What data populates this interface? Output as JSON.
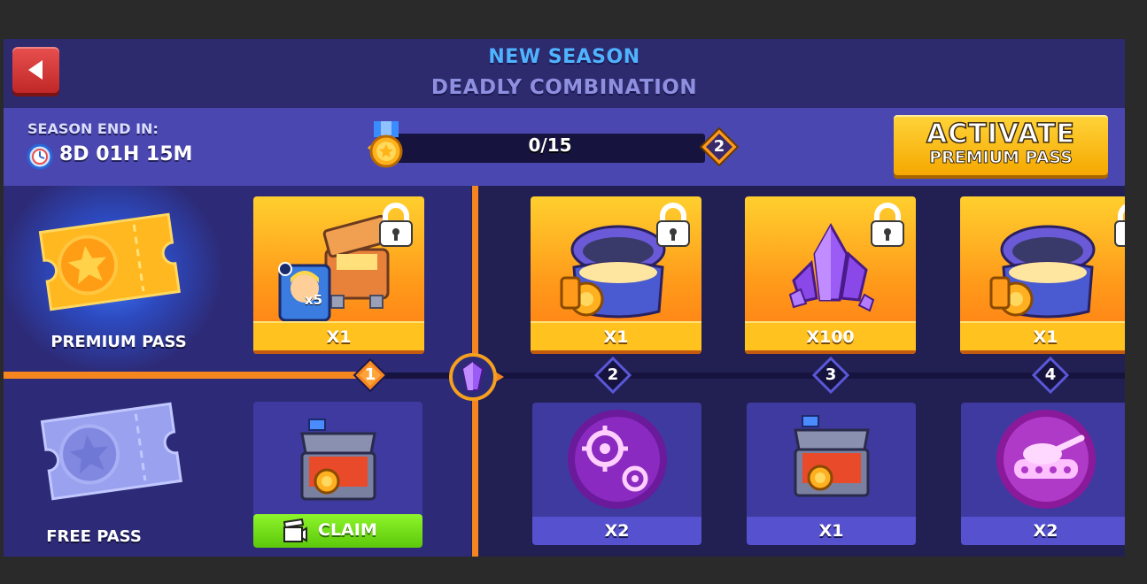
{
  "header": {
    "title": "NEW SEASON",
    "subtitle": "DEADLY COMBINATION",
    "back_icon": "back-arrow-icon"
  },
  "season": {
    "end_label": "SEASON END IN:",
    "time_remaining": "8D 01H 15M"
  },
  "progress": {
    "text": "0/15",
    "current": 0,
    "total": 15,
    "next_level": "2"
  },
  "activate_button": {
    "line1": "ACTIVATE",
    "line2": "PREMIUM PASS"
  },
  "passes": {
    "premium_label": "PREMIUM PASS",
    "free_label": "FREE PASS"
  },
  "track": {
    "levels": [
      "1",
      "2",
      "3",
      "4"
    ]
  },
  "premium_rewards": [
    {
      "qty": "X1",
      "icon": "hero-chest-icon",
      "hero_count": "x5",
      "locked": true
    },
    {
      "qty": "X1",
      "icon": "epic-chest-icon",
      "locked": true
    },
    {
      "qty": "X100",
      "icon": "crystal-icon",
      "locked": true
    },
    {
      "qty": "X1",
      "icon": "epic-chest-icon",
      "locked": true
    }
  ],
  "free_rewards": [
    {
      "qty": "",
      "icon": "chest-icon",
      "claim_label": "CLAIM"
    },
    {
      "qty": "X2",
      "icon": "target-boost-icon"
    },
    {
      "qty": "X1",
      "icon": "chest-icon"
    },
    {
      "qty": "X2",
      "icon": "tank-boost-icon"
    }
  ],
  "colors": {
    "panel": "#2d2a6e",
    "info_bar": "#4a47b0",
    "accent_orange": "#f5861f",
    "premium_gold": "#ffc21f",
    "claim_green": "#6fd814",
    "title_blue": "#4fb3ff"
  }
}
